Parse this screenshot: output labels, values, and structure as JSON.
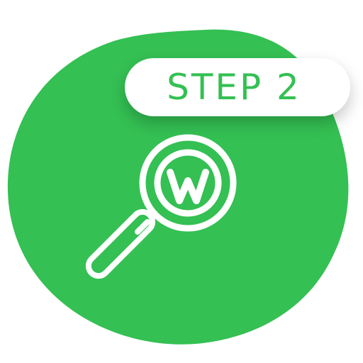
{
  "badge": {
    "label": "STEP 2"
  },
  "icon": {
    "name": "magnifier-w-icon",
    "letter": "W"
  },
  "colors": {
    "accent": "#34c053",
    "badge_background": "#ffffff",
    "icon_stroke": "#ffffff"
  }
}
